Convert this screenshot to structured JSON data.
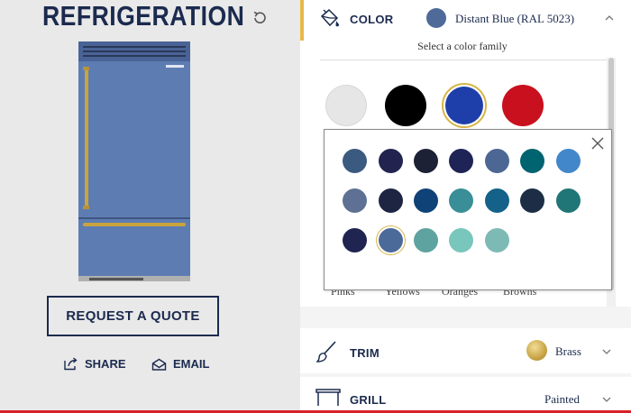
{
  "page": {
    "title": "REFRIGERATION",
    "reset_icon": "reset-icon"
  },
  "actions": {
    "quote_label": "REQUEST A QUOTE",
    "share_label": "SHARE",
    "email_label": "EMAIL"
  },
  "color": {
    "label": "COLOR",
    "selected_name": "Distant Blue (RAL 5023)",
    "selected_hex": "#4d6a99",
    "subtitle": "Select a color family",
    "families": [
      {
        "color": "#e6e6e6"
      },
      {
        "color": "#000000"
      },
      {
        "color": "#1e3faa",
        "selected": true
      },
      {
        "color": "#c8101e"
      }
    ],
    "family_labels": [
      "Pinks",
      "Yellows",
      "Oranges",
      "Browns"
    ],
    "swatches": [
      "#3b5a80",
      "#22244f",
      "#1c2135",
      "#1f2456",
      "#4c6794",
      "#006370",
      "#4287c9",
      "#5e7194",
      "#1e2543",
      "#0f4277",
      "#398e97",
      "#146189",
      "#1c2d45",
      "#207676",
      "#1f2450",
      "#4c6a99",
      "#5ea39f",
      "#78c6bc",
      "#7ebab5"
    ],
    "selected_swatch_index": 15
  },
  "trim": {
    "label": "TRIM",
    "value": "Brass"
  },
  "grill": {
    "label": "GRILL",
    "value": "Painted"
  }
}
